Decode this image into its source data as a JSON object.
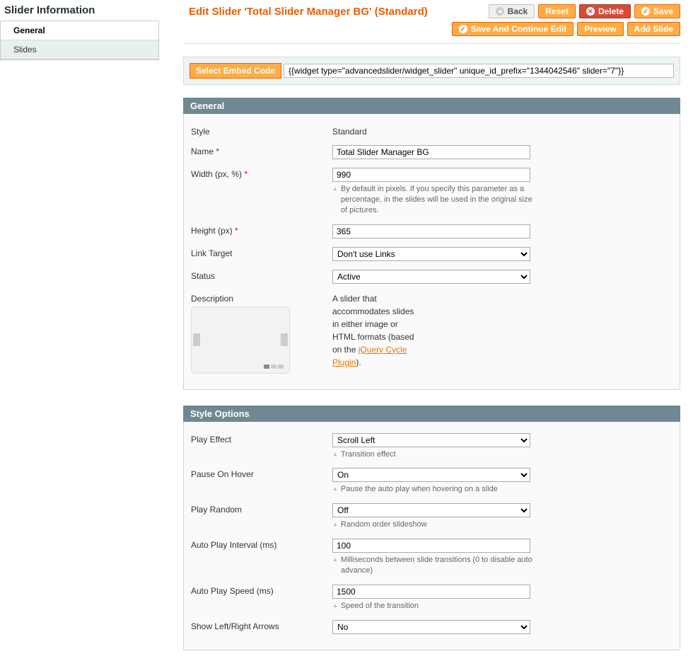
{
  "sidebar": {
    "title": "Slider Information",
    "tabs": [
      {
        "label": "General",
        "active": true
      },
      {
        "label": "Slides",
        "active": false
      }
    ]
  },
  "header": {
    "title": "Edit Slider 'Total Slider Manager BG' (Standard)",
    "buttons": {
      "back": "Back",
      "reset": "Reset",
      "delete": "Delete",
      "save": "Save",
      "save_continue": "Save And Continue Edit",
      "preview": "Preview",
      "add_slide": "Add Slide"
    }
  },
  "embed": {
    "button": "Select Embed Code",
    "value": "{{widget type=\"advancedslider/widget_slider\" unique_id_prefix=\"1344042546\" slider=\"7\"}}"
  },
  "sections": {
    "general": {
      "title": "General",
      "style_label": "Style",
      "style_value": "Standard",
      "name_label": "Name",
      "name_value": "Total Slider Manager BG",
      "width_label": "Width (px, %)",
      "width_value": "990",
      "width_hint": "By default in pixels. If you specify this parameter as a percentage, in the slides will be used in the original size of pictures.",
      "height_label": "Height (px)",
      "height_value": "365",
      "link_target_label": "Link Target",
      "link_target_value": "Don't use Links",
      "status_label": "Status",
      "status_value": "Active",
      "description_label": "Description",
      "description_text_pre": "A slider that accommodates slides in either image or HTML formats (based on the ",
      "description_link": "jQuery Cycle Plugin",
      "description_text_post": ")."
    },
    "style_options": {
      "title": "Style Options",
      "play_effect_label": "Play Effect",
      "play_effect_value": "Scroll Left",
      "play_effect_hint": "Transition effect",
      "pause_hover_label": "Pause On Hover",
      "pause_hover_value": "On",
      "pause_hover_hint": "Pause the auto play when hovering on a slide",
      "play_random_label": "Play Random",
      "play_random_value": "Off",
      "play_random_hint": "Random order slideshow",
      "interval_label": "Auto Play Interval (ms)",
      "interval_value": "100",
      "interval_hint": "Milliseconds between slide transitions (0 to disable auto advance)",
      "speed_label": "Auto Play Speed (ms)",
      "speed_value": "1500",
      "speed_hint": "Speed of the transition",
      "arrows_label": "Show Left/Right Arrows",
      "arrows_value": "No"
    }
  }
}
